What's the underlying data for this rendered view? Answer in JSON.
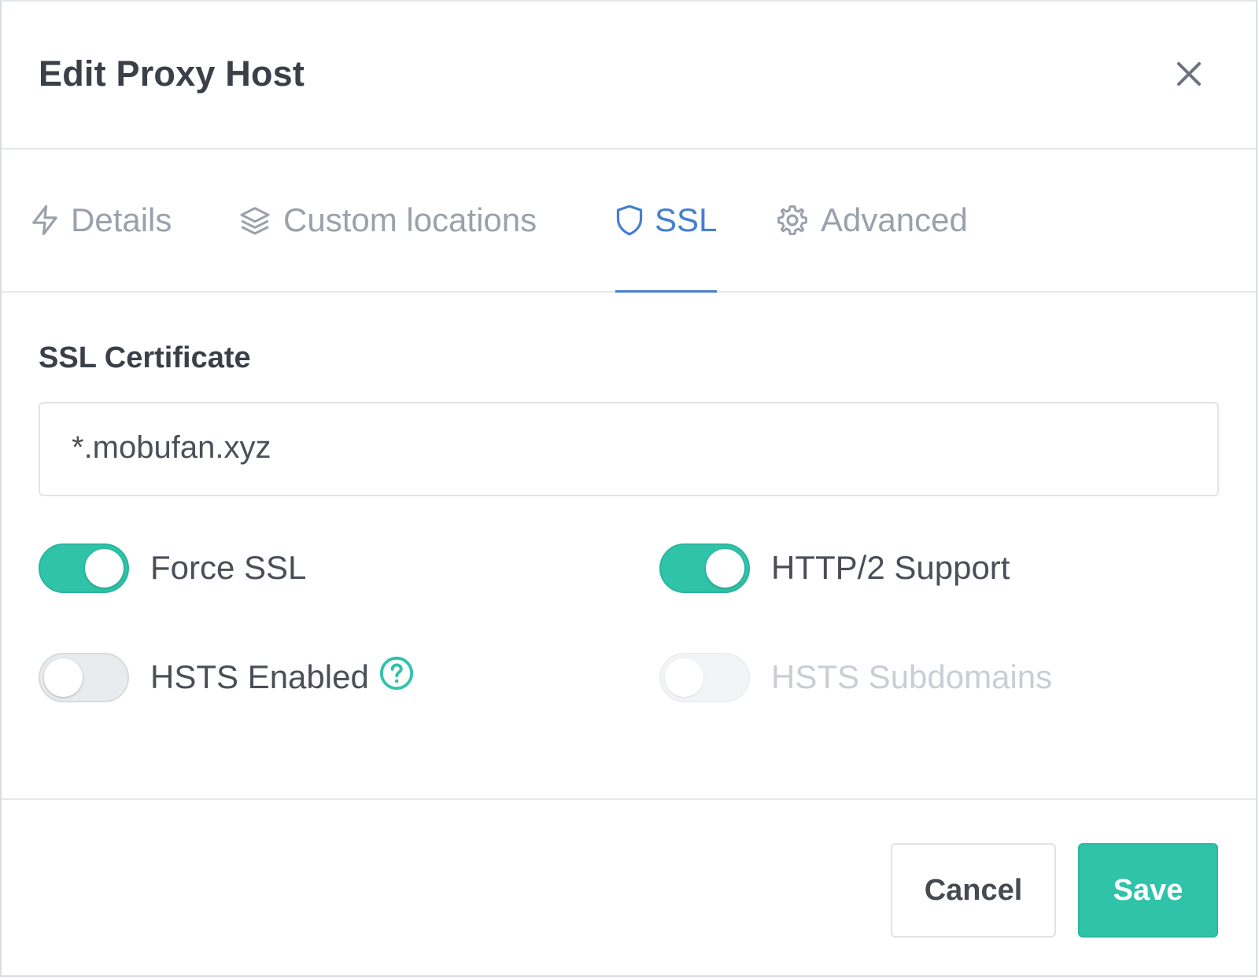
{
  "modal": {
    "title": "Edit Proxy Host"
  },
  "tabs": [
    {
      "label": "Details",
      "icon": "zap-icon",
      "active": false
    },
    {
      "label": "Custom locations",
      "icon": "layers-icon",
      "active": false
    },
    {
      "label": "SSL",
      "icon": "shield-icon",
      "active": true
    },
    {
      "label": "Advanced",
      "icon": "gear-icon",
      "active": false
    }
  ],
  "ssl": {
    "certificate_label": "SSL Certificate",
    "certificate_value": "*.mobufan.xyz",
    "switches": [
      {
        "label": "Force SSL",
        "state": "on"
      },
      {
        "label": "HTTP/2 Support",
        "state": "on"
      },
      {
        "label": "HSTS Enabled",
        "state": "off",
        "help_icon": "question-circle-icon"
      },
      {
        "label": "HSTS Subdomains",
        "state": "off",
        "disabled": true
      }
    ]
  },
  "footer": {
    "cancel_label": "Cancel",
    "save_label": "Save"
  },
  "colors": {
    "accent_teal": "#2fc3a9",
    "active_tab_blue": "#467fcf",
    "muted_text": "#9aa1ab"
  }
}
